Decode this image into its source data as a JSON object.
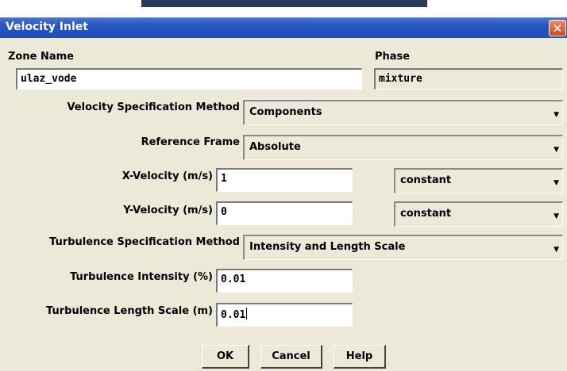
{
  "window": {
    "title": "Velocity Inlet",
    "close_glyph": "✕"
  },
  "zone": {
    "label": "Zone Name",
    "value": "ulaz_vode"
  },
  "phase": {
    "label": "Phase",
    "value": "mixture"
  },
  "velocity_method": {
    "label": "Velocity Specification Method",
    "value": "Components"
  },
  "reference_frame": {
    "label": "Reference Frame",
    "value": "Absolute"
  },
  "x_velocity": {
    "label": "X-Velocity (m/s)",
    "value": "1",
    "profile": "constant"
  },
  "y_velocity": {
    "label": "Y-Velocity (m/s)",
    "value": "0",
    "profile": "constant"
  },
  "turbulence_method": {
    "label": "Turbulence Specification Method",
    "value": "Intensity and Length Scale"
  },
  "turb_intensity": {
    "label": "Turbulence Intensity (%)",
    "value": "0.01"
  },
  "turb_length": {
    "label": "Turbulence Length Scale (m)",
    "value": "0.01"
  },
  "buttons": {
    "ok": "OK",
    "cancel": "Cancel",
    "help": "Help"
  },
  "icons": {
    "dropdown": "chevron-down-icon",
    "close": "close-icon"
  },
  "colors": {
    "titlebar": "#2456c4",
    "close": "#d04a1f",
    "dialog_bg": "#ece9d8"
  }
}
